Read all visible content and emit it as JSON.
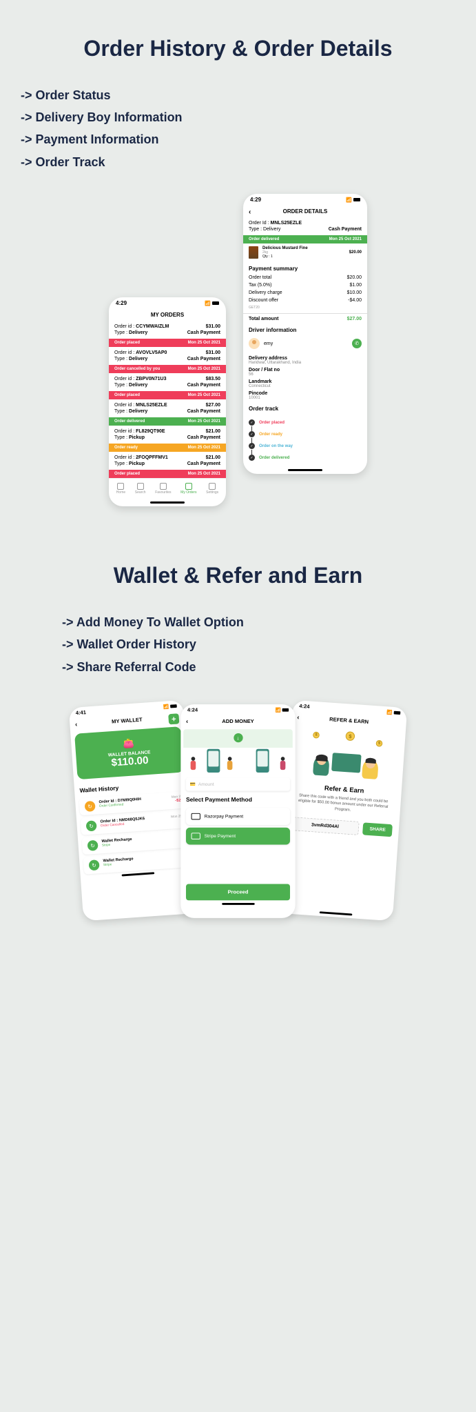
{
  "section1": {
    "title": "Order History & Order Details",
    "features": [
      "-> Order Status",
      "-> Delivery Boy Information",
      "-> Payment Information",
      "-> Order Track"
    ]
  },
  "myOrders": {
    "time": "4:29",
    "title": "MY ORDERS",
    "orderIdLabel": "Order id :",
    "typeLabel": "Type :",
    "orders": [
      {
        "id": "CCYMWAIZLM",
        "amount": "$31.00",
        "type": "Delivery",
        "payment": "Cash Payment",
        "status": "Order placed",
        "date": "Mon 25 Oct 2021",
        "statusClass": "status-red"
      },
      {
        "id": "AVOVLV5AP0",
        "amount": "$31.00",
        "type": "Delivery",
        "payment": "Cash Payment",
        "status": "Order cancelled by you",
        "date": "Mon 25 Oct 2021",
        "statusClass": "status-red"
      },
      {
        "id": "ZBPV0N71U3",
        "amount": "$83.50",
        "type": "Delivery",
        "payment": "Cash Payment",
        "status": "Order placed",
        "date": "Mon 25 Oct 2021",
        "statusClass": "status-red"
      },
      {
        "id": "MNLS25EZLE",
        "amount": "$27.00",
        "type": "Delivery",
        "payment": "Cash Payment",
        "status": "Order delivered",
        "date": "Mon 25 Oct 2021",
        "statusClass": "status-green"
      },
      {
        "id": "FL829QT90E",
        "amount": "$21.00",
        "type": "Pickup",
        "payment": "Cash Payment",
        "status": "Order ready",
        "date": "Mon 25 Oct 2021",
        "statusClass": "status-orange"
      },
      {
        "id": "2FOQPFFMV1",
        "amount": "$21.00",
        "type": "Pickup",
        "payment": "Cash Payment",
        "status": "Order placed",
        "date": "Mon 25 Oct 2021",
        "statusClass": "status-red"
      }
    ],
    "nav": [
      {
        "label": "Home"
      },
      {
        "label": "Search"
      },
      {
        "label": "Favourites"
      },
      {
        "label": "My Orders"
      },
      {
        "label": "Settings"
      }
    ]
  },
  "orderDetails": {
    "time": "4:29",
    "title": "ORDER DETAILS",
    "orderIdLabel": "Order Id :",
    "orderId": "MNLS25EZLE",
    "typeLabel": "Type :",
    "type": "Delivery",
    "payment": "Cash Payment",
    "statusLabel": "Order delivered",
    "statusDate": "Mon 25 Oct 2021",
    "item": {
      "name": "Delicious Mustard Fine",
      "weight": "2kg",
      "qtyLabel": "Qty :",
      "qty": "1",
      "price": "$20.00"
    },
    "paymentSummaryLabel": "Payment summary",
    "summary": [
      {
        "label": "Order total",
        "value": "$20.00"
      },
      {
        "label": "Tax (5.0%)",
        "value": "$1.00"
      },
      {
        "label": "Delivery charge",
        "value": "$10.00"
      },
      {
        "label": "Discount offer",
        "value": "-$4.00",
        "sub": "GET20"
      }
    ],
    "totalLabel": "Total amount",
    "totalValue": "$27.00",
    "driverLabel": "Driver information",
    "driverName": "emy",
    "addressLabel": "Delivery address",
    "address": "Haridwar, Uttarakhand, India",
    "doorLabel": "Door / Flat no",
    "door": "56",
    "landmarkLabel": "Landmark",
    "landmark": "Connecticut",
    "pincodeLabel": "Pincode",
    "pincode": "10001",
    "trackLabel": "Order track",
    "track": [
      {
        "label": "Order placed",
        "class": "track-placed"
      },
      {
        "label": "Order ready",
        "class": "track-ready"
      },
      {
        "label": "Order on the way",
        "class": "track-way"
      },
      {
        "label": "Order delivered",
        "class": "track-delivered"
      }
    ]
  },
  "section2": {
    "title": "Wallet & Refer and Earn",
    "features": [
      "-> Add Money To Wallet Option",
      "-> Wallet Order History",
      "-> Share Referral Code"
    ]
  },
  "wallet": {
    "time": "4:41",
    "title": "MY WALLET",
    "balanceLabel": "WALLET BALANCE",
    "balance": "$110.00",
    "historyLabel": "Wallet History",
    "items": [
      {
        "iconClass": "wh-icon-orange",
        "label": "Order Id : D7MI9Q0HIH",
        "status": "Order Confirmed",
        "statusClass": "wh-status-g",
        "date": "Mon 2",
        "amount": "-$2"
      },
      {
        "iconClass": "wh-icon-green",
        "label": "Order Id : NMD68Q5JK6",
        "status": "Order Cancelled",
        "statusClass": "wh-status-r",
        "date": "Mon 25",
        "amount": ""
      },
      {
        "iconClass": "wh-icon-green",
        "label": "Wallet Recharge",
        "status": "Stripe",
        "statusClass": "wh-status-g",
        "date": "",
        "amount": ""
      },
      {
        "iconClass": "wh-icon-green",
        "label": "Wallet Recharge",
        "status": "Stripe",
        "statusClass": "wh-status-g",
        "date": "",
        "amount": ""
      }
    ]
  },
  "addMoney": {
    "time": "4:24",
    "title": "ADD MONEY",
    "amountPlaceholder": "Amount",
    "methodLabel": "Select Payment Method",
    "options": [
      {
        "label": "Razorpay Payment",
        "selected": false
      },
      {
        "label": "Stripe Payment",
        "selected": true
      }
    ],
    "proceed": "Proceed"
  },
  "refer": {
    "time": "4:24",
    "title": "REFER & EARN",
    "head": "Refer & Earn",
    "desc": "Share this code with a friend and you both could be eligible for $50.00 bonus amount under our Referral Program.",
    "code": "3vmRd304Al",
    "share": "SHARE"
  }
}
